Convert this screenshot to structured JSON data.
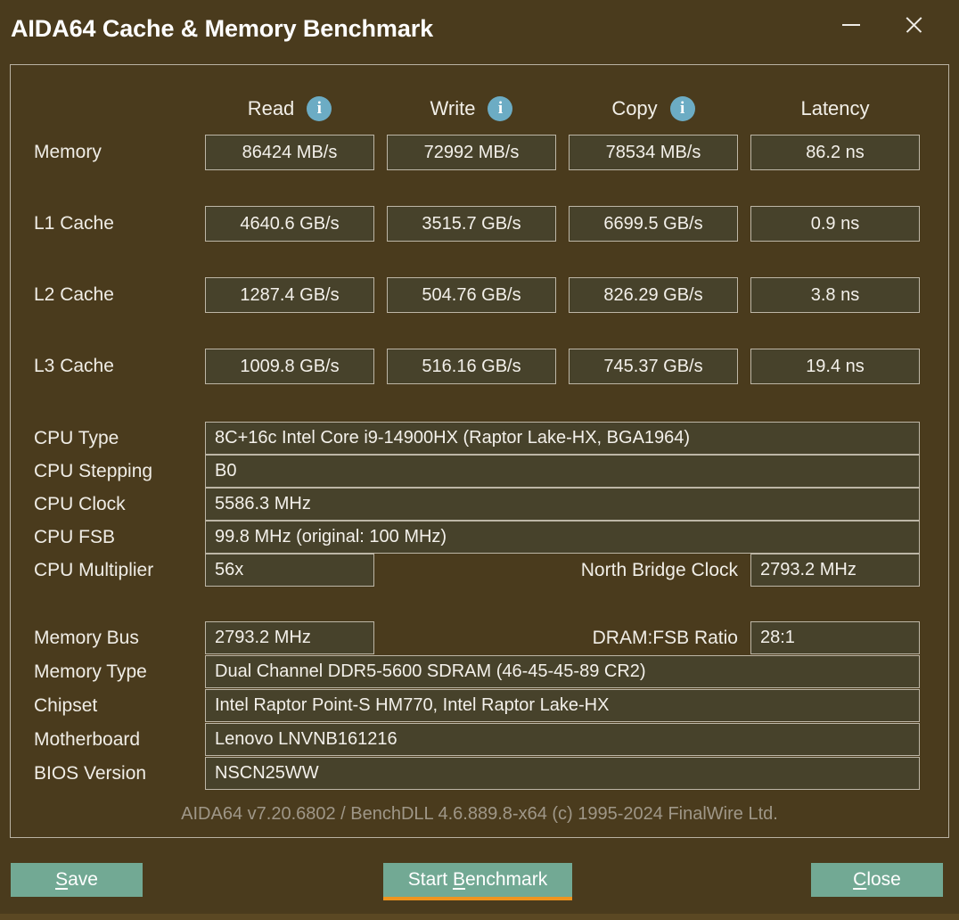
{
  "window": {
    "title": "AIDA64 Cache & Memory Benchmark",
    "minimize_label": "Minimize",
    "close_label": "Close"
  },
  "columns": [
    {
      "label": "Read",
      "info_icon": "info-icon",
      "has_info": true
    },
    {
      "label": "Write",
      "info_icon": "info-icon",
      "has_info": true
    },
    {
      "label": "Copy",
      "info_icon": "info-icon",
      "has_info": true
    },
    {
      "label": "Latency",
      "info_icon": "",
      "has_info": false
    }
  ],
  "benchmark": {
    "rows": [
      {
        "label": "Memory",
        "read": "86424 MB/s",
        "write": "72992 MB/s",
        "copy": "78534 MB/s",
        "latency": "86.2 ns"
      },
      {
        "label": "L1 Cache",
        "read": "4640.6 GB/s",
        "write": "3515.7 GB/s",
        "copy": "6699.5 GB/s",
        "latency": "0.9 ns"
      },
      {
        "label": "L2 Cache",
        "read": "1287.4 GB/s",
        "write": "504.76 GB/s",
        "copy": "826.29 GB/s",
        "latency": "3.8 ns"
      },
      {
        "label": "L3 Cache",
        "read": "1009.8 GB/s",
        "write": "516.16 GB/s",
        "copy": "745.37 GB/s",
        "latency": "19.4 ns"
      }
    ]
  },
  "cpu_info": {
    "cpu_type": {
      "label": "CPU Type",
      "value": "8C+16c Intel Core i9-14900HX  (Raptor Lake-HX, BGA1964)"
    },
    "cpu_stepping": {
      "label": "CPU Stepping",
      "value": "B0"
    },
    "cpu_clock": {
      "label": "CPU Clock",
      "value": "5586.3 MHz"
    },
    "cpu_fsb": {
      "label": "CPU FSB",
      "value": "99.8 MHz  (original: 100 MHz)"
    },
    "cpu_multiplier": {
      "label": "CPU Multiplier",
      "value": "56x"
    },
    "north_bridge": {
      "label": "North Bridge Clock",
      "value": "2793.2 MHz"
    }
  },
  "memory_info": {
    "memory_bus": {
      "label": "Memory Bus",
      "value": "2793.2 MHz"
    },
    "dram_fsb": {
      "label": "DRAM:FSB Ratio",
      "value": "28:1"
    },
    "memory_type": {
      "label": "Memory Type",
      "value": "Dual Channel DDR5-5600 SDRAM  (46-45-45-89 CR2)"
    },
    "chipset": {
      "label": "Chipset",
      "value": "Intel Raptor Point-S HM770, Intel Raptor Lake-HX"
    },
    "motherboard": {
      "label": "Motherboard",
      "value": "Lenovo LNVNB161216"
    },
    "bios_version": {
      "label": "BIOS Version",
      "value": "NSCN25WW"
    }
  },
  "footer": {
    "version_line": "AIDA64 v7.20.6802 / BenchDLL 4.6.889.8-x64  (c) 1995-2024 FinalWire Ltd."
  },
  "buttons": {
    "save": {
      "prefix": "",
      "accel": "S",
      "suffix": "ave"
    },
    "start": {
      "prefix": "Start ",
      "accel": "B",
      "suffix": "enchmark"
    },
    "close": {
      "prefix": "",
      "accel": "C",
      "suffix": "lose"
    }
  },
  "colors": {
    "window_bg": "#4a3b1d",
    "field_bg": "#47422b",
    "field_border": "#bdb6a6",
    "button_bg": "#72a994",
    "focus_accent": "#f0941e",
    "info_icon_bg": "#6cacc4",
    "text": "#f0ede6",
    "muted_text": "#9f9788"
  }
}
